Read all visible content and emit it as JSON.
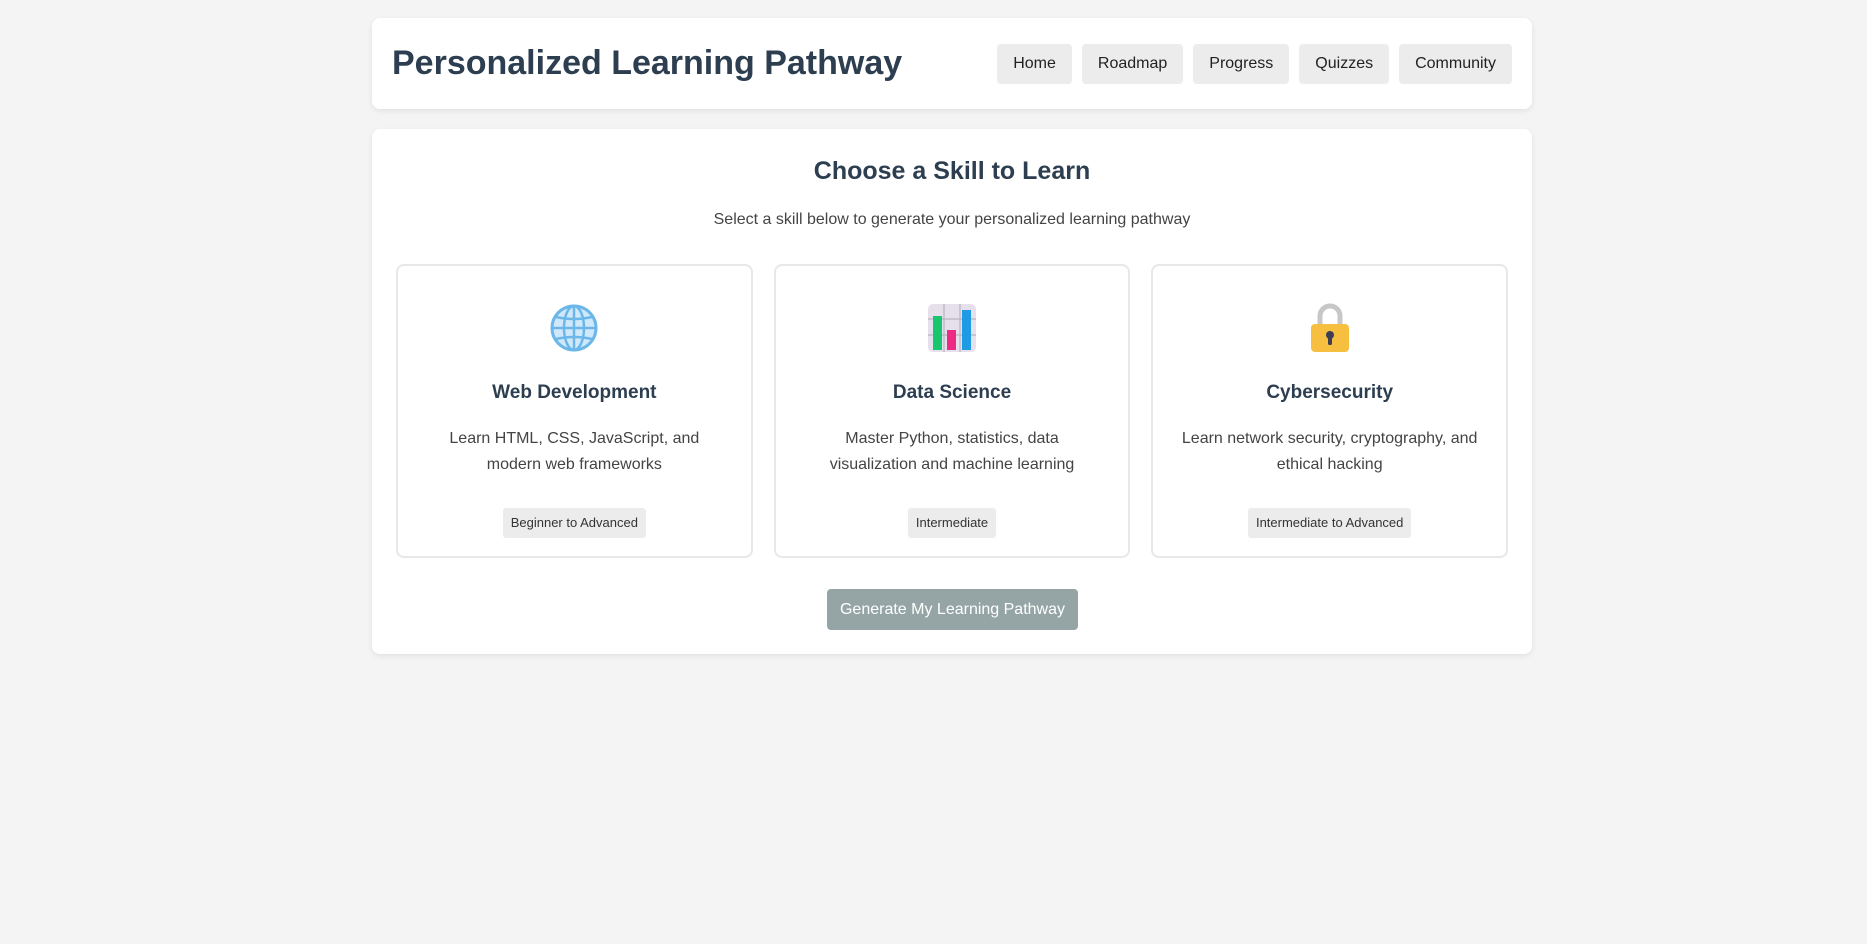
{
  "header": {
    "title": "Personalized Learning Pathway",
    "nav": [
      "Home",
      "Roadmap",
      "Progress",
      "Quizzes",
      "Community"
    ]
  },
  "main": {
    "title": "Choose a Skill to Learn",
    "subtitle": "Select a skill below to generate your personalized learning pathway",
    "skills": [
      {
        "icon": "globe-icon",
        "title": "Web Development",
        "description": "Learn HTML, CSS, JavaScript, and modern web frameworks",
        "level": "Beginner to Advanced"
      },
      {
        "icon": "bar-chart-icon",
        "title": "Data Science",
        "description": "Master Python, statistics, data visualization and machine learning",
        "level": "Intermediate"
      },
      {
        "icon": "lock-icon",
        "title": "Cybersecurity",
        "description": "Learn network security, cryptography, and ethical hacking",
        "level": "Intermediate to Advanced"
      }
    ],
    "generate_label": "Generate My Learning Pathway"
  },
  "colors": {
    "title": "#2c3e50",
    "page_bg": "#f4f4f4",
    "button_disabled": "#95a5a6"
  }
}
